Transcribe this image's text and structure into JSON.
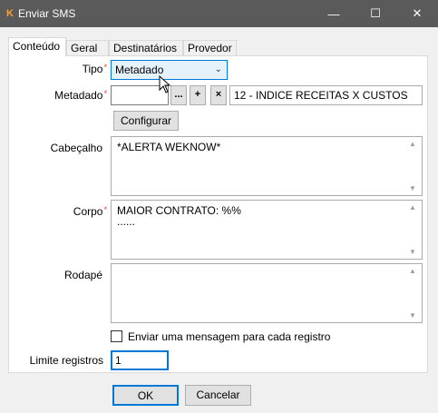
{
  "window": {
    "title": "Enviar SMS",
    "icon": "K",
    "minimize": "—",
    "maximize": "☐",
    "close": "✕"
  },
  "tabs": [
    {
      "label": "Conteúdo",
      "active": true
    },
    {
      "label": "Geral",
      "active": false
    },
    {
      "label": "Destinatários",
      "active": false
    },
    {
      "label": "Provedor",
      "active": false
    }
  ],
  "form": {
    "tipo_label": "Tipo",
    "tipo_value": "Metadado",
    "metadado_label": "Metadado",
    "metadado_value": "",
    "metadado_ellipsis": "...",
    "metadado_plus": "+",
    "metadado_remove": "×",
    "metadado_description": "12 - INDICE RECEITAS X CUSTOS",
    "configurar_label": "Configurar",
    "cabecalho_label": "Cabeçalho",
    "cabecalho_value": "*ALERTA WEKNOW*",
    "corpo_label": "Corpo",
    "corpo_line1": "MAIOR CONTRATO: %%",
    "corpo_line2": "......",
    "rodape_label": "Rodapé",
    "rodape_value": "",
    "checkbox_label": "Enviar uma mensagem para cada registro",
    "checkbox_checked": false,
    "limite_label": "Limite registros",
    "limite_value": "1",
    "required_marker": "*"
  },
  "footer": {
    "ok_label": "OK",
    "cancel_label": "Cancelar"
  },
  "colors": {
    "titlebar": "#5a5a5a",
    "required": "#e53935",
    "focus_border": "#0078d7"
  }
}
